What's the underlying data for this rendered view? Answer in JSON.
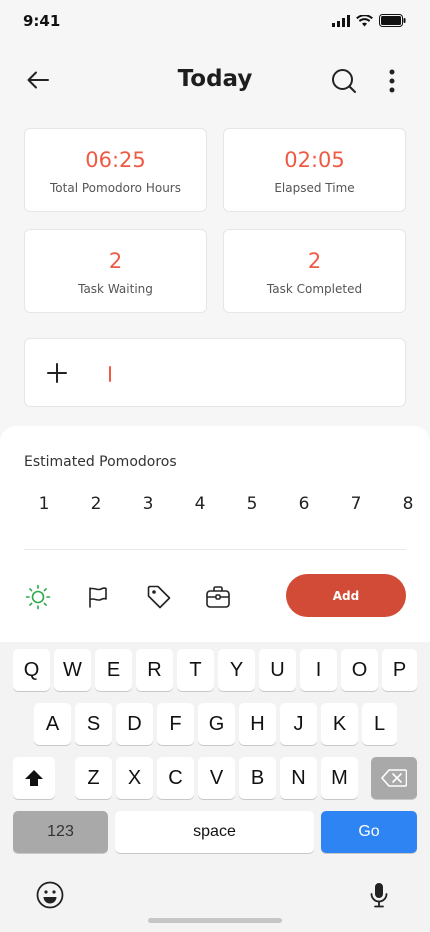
{
  "status_bar": {
    "time": "9:41"
  },
  "header": {
    "title": "Today"
  },
  "stats": [
    {
      "value": "06:25",
      "label": "Total Pomodoro Hours"
    },
    {
      "value": "02:05",
      "label": "Elapsed Time"
    },
    {
      "value": "2",
      "label": "Task Waiting"
    },
    {
      "value": "2",
      "label": "Task Completed"
    }
  ],
  "sheet": {
    "title": "Estimated Pomodoros",
    "numbers": [
      "1",
      "2",
      "3",
      "4",
      "5",
      "6",
      "7",
      "8"
    ],
    "add_label": "Add",
    "tool_icons": [
      "sun-icon",
      "flag-icon",
      "tag-icon",
      "briefcase-icon"
    ]
  },
  "keyboard": {
    "row1": [
      "Q",
      "W",
      "E",
      "R",
      "T",
      "Y",
      "U",
      "I",
      "O",
      "P"
    ],
    "row2": [
      "A",
      "S",
      "D",
      "F",
      "G",
      "H",
      "J",
      "K",
      "L"
    ],
    "row3": [
      "Z",
      "X",
      "C",
      "V",
      "B",
      "N",
      "M"
    ],
    "numbers_key": "123",
    "space_key": "space",
    "go_key": "Go"
  },
  "colors": {
    "accent": "#ef5a45",
    "add_button": "#d24b37",
    "go_key": "#2f84f3",
    "sun_icon": "#2ea84a"
  }
}
